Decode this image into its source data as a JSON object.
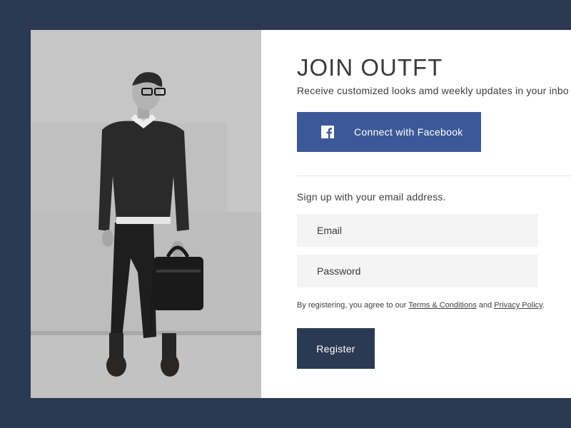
{
  "colors": {
    "page_background": "#2b3a52",
    "card_background": "#ffffff",
    "facebook_blue": "#3b5998",
    "register_button": "#2b3a52",
    "input_background": "#f4f4f4"
  },
  "photo": {
    "description_icon": "person-with-bag-photo"
  },
  "signup": {
    "title": "JOIN OUTFT",
    "subtitle": "Receive customized looks amd weekly updates in your inbo",
    "facebook_button": {
      "label": "Connect with Facebook",
      "icon": "facebook-icon"
    },
    "email_prompt": "Sign up with your email address.",
    "email_placeholder": "Email",
    "password_placeholder": "Password",
    "legal": {
      "prefix": "By registering, you agree to our ",
      "terms_link": "Terms & Conditions",
      "middle": " and ",
      "privacy_link": "Privacy Policy",
      "suffix": "."
    },
    "register_button": "Register"
  }
}
